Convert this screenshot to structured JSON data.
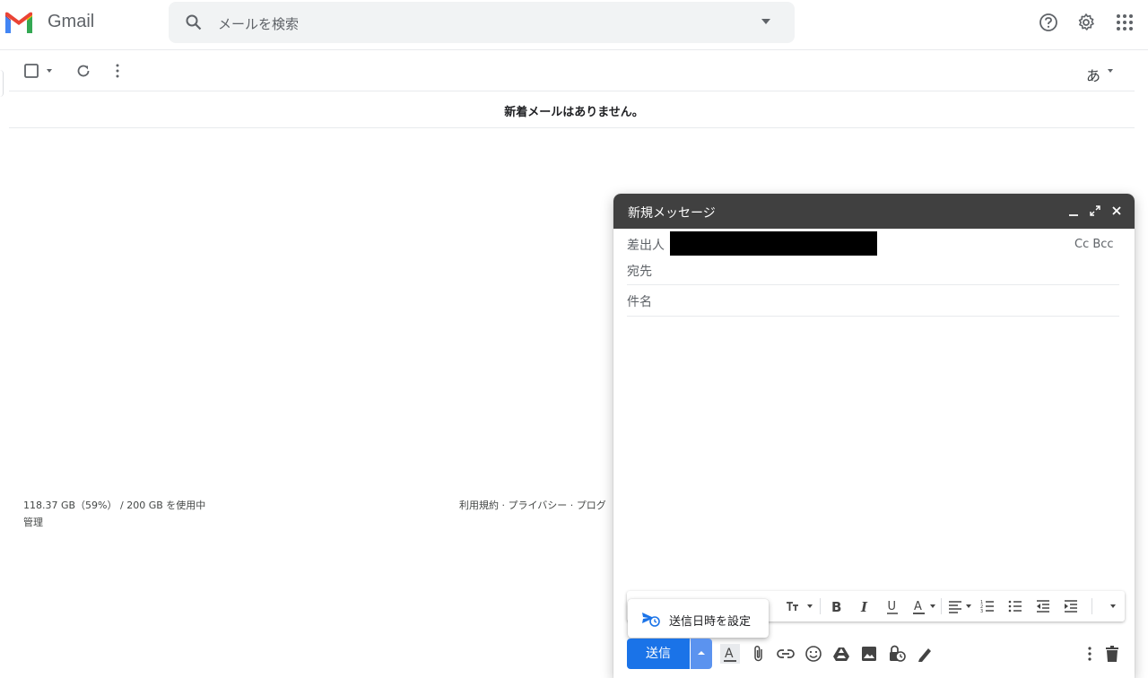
{
  "app": {
    "name": "Gmail",
    "colors": {
      "accent": "#1a73e8",
      "compose_header": "#404040",
      "search_bg": "#f1f3f4"
    }
  },
  "search": {
    "placeholder": "メールを検索",
    "icon": "search-icon",
    "options_icon": "caret-down-icon"
  },
  "header_icons": [
    "help-icon",
    "settings-gear-icon",
    "apps-grid-icon"
  ],
  "toolbar": {
    "icons": [
      "select-checkbox-icon",
      "caret-down-icon",
      "refresh-icon",
      "more-vert-icon"
    ],
    "input_tool_label": "あ"
  },
  "mail_list": {
    "empty_message": "新着メールはありません。"
  },
  "footer": {
    "storage": "118.37 GB（59%） / 200 GB を使用中",
    "manage": "管理",
    "links": "利用規約 · プライバシー · プログ"
  },
  "compose": {
    "title": "新規メッセージ",
    "header_icons": [
      "minimize-icon",
      "expand-icon",
      "close-icon"
    ],
    "from_label": "差出人",
    "cc_bcc": "Cc Bcc",
    "to_label": "宛先",
    "subject_label": "件名",
    "format_icons": [
      "text-size-icon",
      "bold-icon",
      "italic-icon",
      "underline-icon",
      "text-color-icon",
      "align-icon",
      "numbered-list-icon",
      "bulleted-list-icon",
      "indent-less-icon",
      "indent-more-icon",
      "more-formatting-icon"
    ],
    "schedule_send_label": "送信日時を設定",
    "send_label": "送信",
    "bottom_icons": [
      "formatting-options-icon",
      "attach-icon",
      "link-icon",
      "emoji-icon",
      "drive-icon",
      "photo-icon",
      "confidential-icon",
      "signature-icon",
      "more-options-icon",
      "discard-trash-icon"
    ]
  }
}
